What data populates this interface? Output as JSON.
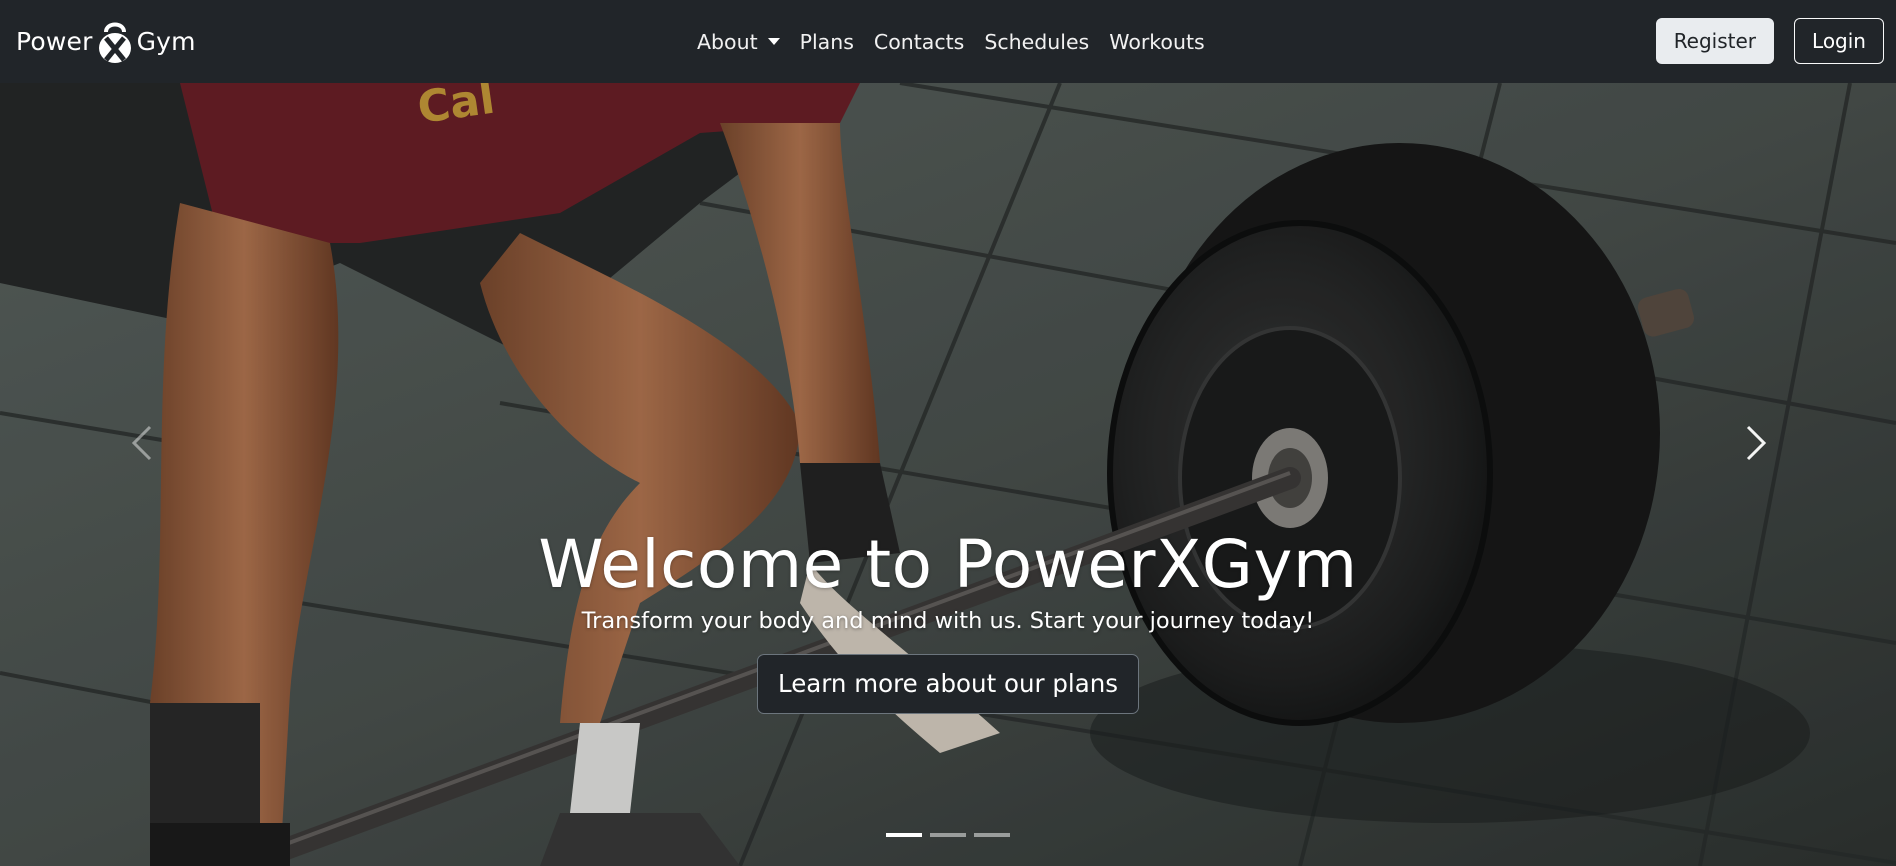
{
  "brand": {
    "left": "Power",
    "mark": "X",
    "right": "Gym"
  },
  "nav": {
    "items": [
      {
        "label": "About",
        "dropdown": true
      },
      {
        "label": "Plans"
      },
      {
        "label": "Contacts"
      },
      {
        "label": "Schedules"
      },
      {
        "label": "Workouts"
      }
    ]
  },
  "auth": {
    "register_label": "Register",
    "login_label": "Login"
  },
  "hero": {
    "title": "Welcome to PowerXGym",
    "subtitle": "Transform your body and mind with us. Start your journey today!",
    "cta_label": "Learn more about our plans"
  },
  "carousel": {
    "slide_count": 3,
    "active_index": 0
  },
  "colors": {
    "navbar": "#212529",
    "register_bg": "#e9ecef",
    "text": "#ffffff"
  },
  "icons": {
    "logo": "kettlebell-icon",
    "prev": "chevron-left-icon",
    "next": "chevron-right-icon",
    "dropdown": "caret-down-icon"
  }
}
